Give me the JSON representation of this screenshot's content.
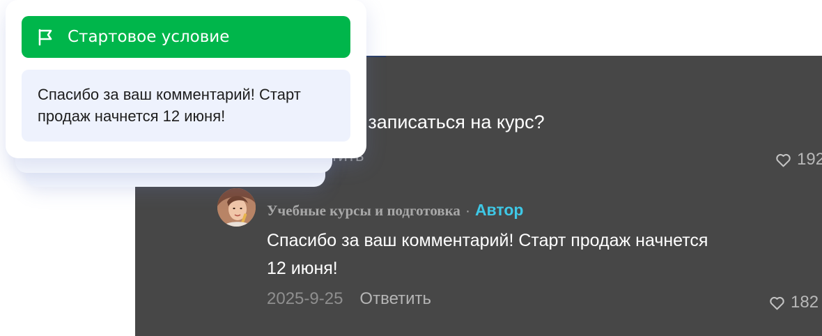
{
  "trigger_card": {
    "title": "Стартовое условие",
    "title_icon": "flag-icon",
    "message": "Спасибо за ваш комментарий! Старт продаж начнется 12 июня!"
  },
  "comments": {
    "first": {
      "text": "ак записаться на курс?",
      "reply_label": "етить",
      "likes": "192"
    },
    "second": {
      "author": "Учебные курсы и подготовка",
      "separator": "·",
      "badge": "Автор",
      "text": "Спасибо за ваш комментарий! Старт продаж начнется 12 июня!",
      "date": "2025-9-25",
      "reply_label": "Ответить",
      "likes": "182"
    }
  },
  "colors": {
    "panel_bg": "#474747",
    "trigger_green": "#00b64b",
    "author_badge": "#3ec8e6",
    "message_bg": "#eef2fd"
  }
}
